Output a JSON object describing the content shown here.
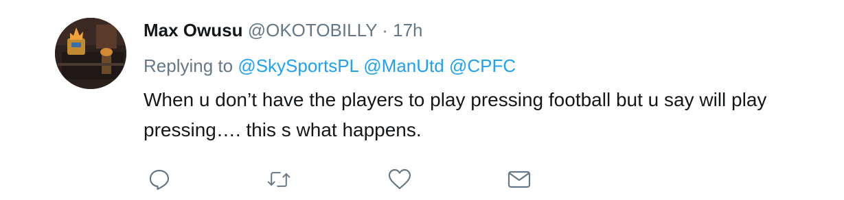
{
  "tweet": {
    "author": {
      "name": "Max Owusu",
      "handle": "@OKOTOBILLY",
      "separator": "·",
      "time": "17h"
    },
    "replying": {
      "prefix": "Replying to",
      "mentions": [
        "@SkySportsPL",
        "@ManUtd",
        "@CPFC"
      ]
    },
    "text_lines": [
      "When u don’t have the players to play pressing football but u say will play",
      "pressing…. this s what happens."
    ]
  },
  "actions": [
    {
      "icon": "reply-icon"
    },
    {
      "icon": "retweet-icon"
    },
    {
      "icon": "like-icon"
    },
    {
      "icon": "direct-message-icon"
    }
  ],
  "colors": {
    "text": "#14171a",
    "muted": "#657786",
    "link": "#1da1f2"
  }
}
